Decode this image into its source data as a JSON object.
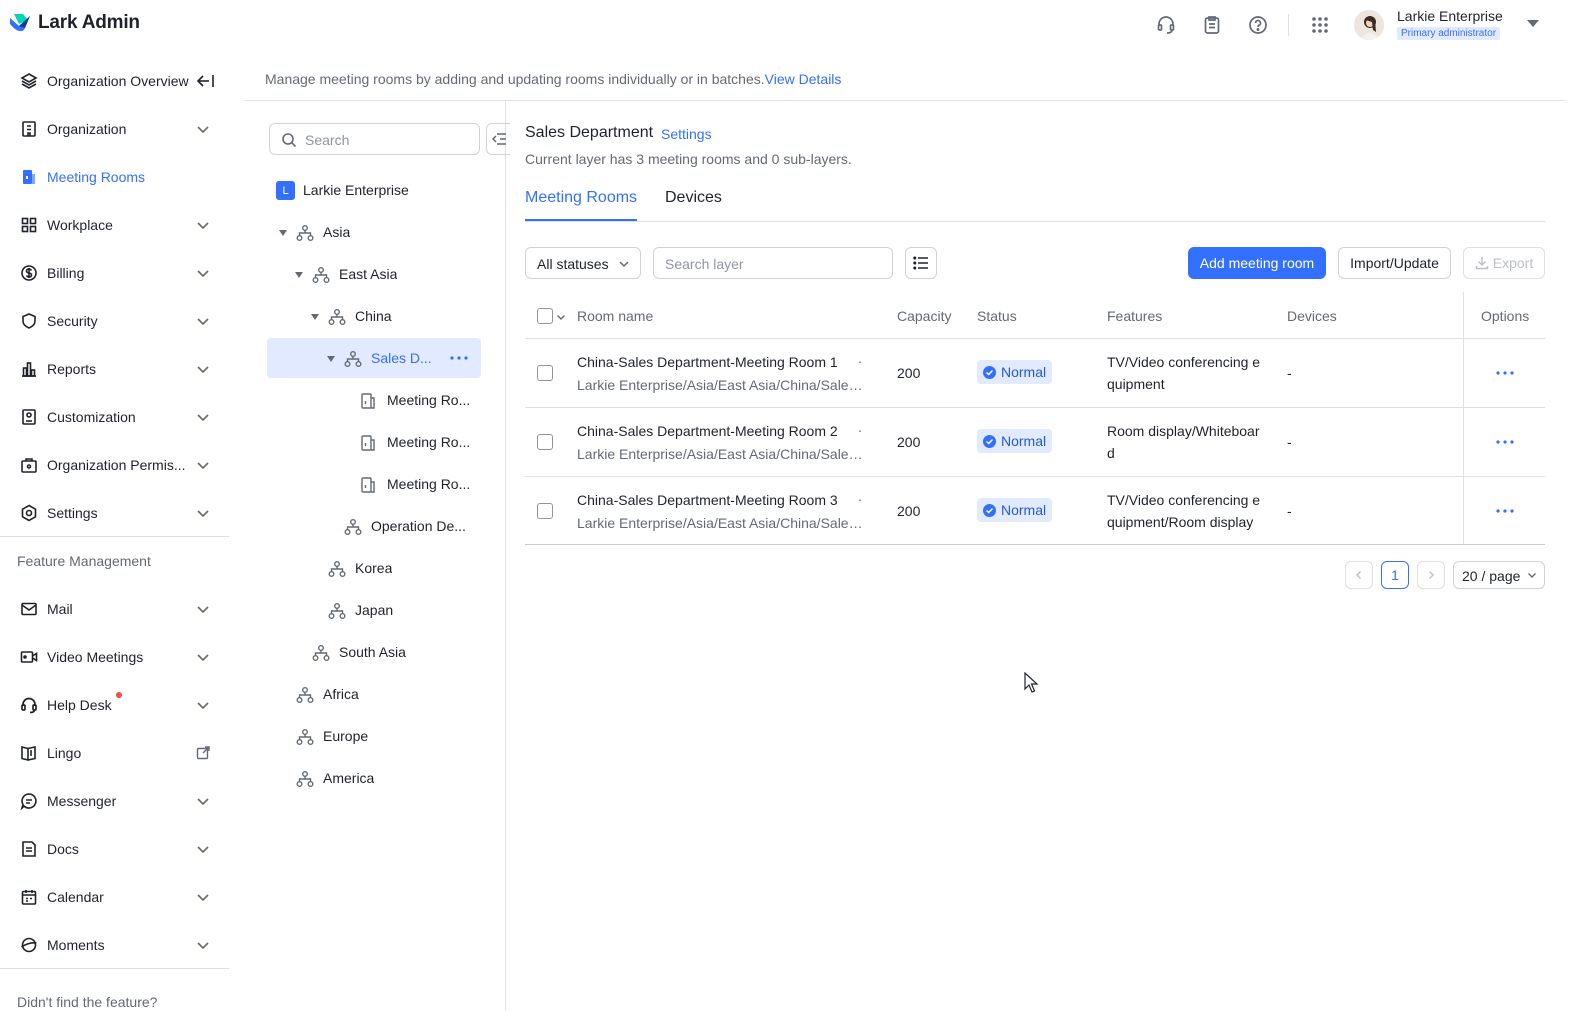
{
  "header": {
    "app_name": "Lark Admin",
    "user_name": "Larkie Enterprise",
    "user_role": "Primary administrator",
    "icons": [
      "headset-icon",
      "clipboard-icon",
      "help-icon",
      "apps-grid-icon"
    ]
  },
  "sidebar": {
    "items": [
      {
        "label": "Organization Overview",
        "icon": "layers-icon"
      },
      {
        "label": "Organization",
        "icon": "building-icon"
      },
      {
        "label": "Meeting Rooms",
        "icon": "meeting-room-icon",
        "active": true
      },
      {
        "label": "Workplace",
        "icon": "grid-icon"
      },
      {
        "label": "Billing",
        "icon": "dollar-icon"
      },
      {
        "label": "Security",
        "icon": "shield-icon"
      },
      {
        "label": "Reports",
        "icon": "bar-chart-icon"
      },
      {
        "label": "Customization",
        "icon": "customize-icon"
      },
      {
        "label": "Organization Permis...",
        "icon": "briefcase-icon"
      },
      {
        "label": "Settings",
        "icon": "gear-icon"
      }
    ],
    "section_title": "Feature Management",
    "feature_items": [
      {
        "label": "Mail",
        "icon": "mail-icon"
      },
      {
        "label": "Video Meetings",
        "icon": "video-icon"
      },
      {
        "label": "Help Desk",
        "icon": "headset-icon"
      },
      {
        "label": "Lingo",
        "icon": "book-icon"
      },
      {
        "label": "Messenger",
        "icon": "chat-icon"
      },
      {
        "label": "Docs",
        "icon": "doc-icon"
      },
      {
        "label": "Calendar",
        "icon": "calendar-icon"
      },
      {
        "label": "Moments",
        "icon": "moments-icon"
      }
    ],
    "footer": "Didn't find the feature?"
  },
  "notice": {
    "text": "Manage meeting rooms by adding and updating rooms individually or in batches.",
    "link": "View Details"
  },
  "tree": {
    "search_placeholder": "Search",
    "root": "Larkie Enterprise",
    "root_badge": "L",
    "nodes": [
      "Asia",
      "East Asia",
      "China",
      "Sales D...",
      "Meeting Ro...",
      "Meeting Ro...",
      "Meeting Ro...",
      "Operation De...",
      "Korea",
      "Japan",
      "South Asia",
      "Africa",
      "Europe",
      "America"
    ]
  },
  "content": {
    "title": "Sales Department",
    "settings_link": "Settings",
    "subtitle": "Current layer has 3 meeting rooms and 0 sub-layers.",
    "tabs": [
      "Meeting Rooms",
      "Devices"
    ],
    "filter_status": "All statuses",
    "search_placeholder": "Search layer",
    "add_button": "Add meeting room",
    "import_button": "Import/Update",
    "export_button": "Export",
    "columns": [
      "Room name",
      "Capacity",
      "Status",
      "Features",
      "Devices",
      "Options"
    ],
    "rows": [
      {
        "name": "China-Sales Department-Meeting Room 1",
        "path": "Larkie Enterprise/Asia/East Asia/China/Sales Department",
        "capacity": "200",
        "status": "Normal",
        "features": "TV/Video conferencing equipment",
        "devices": "-"
      },
      {
        "name": "China-Sales Department-Meeting Room 2",
        "path": "Larkie Enterprise/Asia/East Asia/China/Sales Department",
        "capacity": "200",
        "status": "Normal",
        "features": "Room display/Whiteboard",
        "devices": "-"
      },
      {
        "name": "China-Sales Department-Meeting Room 3",
        "path": "Larkie Enterprise/Asia/East Asia/China/Sales Department",
        "capacity": "200",
        "status": "Normal",
        "features": "TV/Video conferencing equipment/Room display",
        "devices": "-"
      }
    ],
    "pagination": {
      "current": "1",
      "page_size": "20 / page"
    }
  },
  "colors": {
    "accent": "#3370ff",
    "badge_bg": "#e1eaff",
    "text": "#1f2329",
    "muted": "#646a73"
  }
}
